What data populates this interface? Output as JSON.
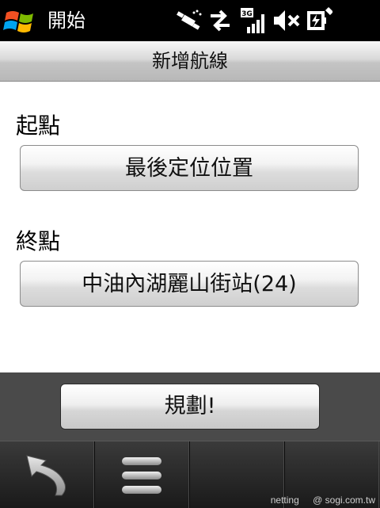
{
  "status_bar": {
    "start_label": "開始",
    "icons": [
      "windows-flag-icon",
      "gps-satellite-icon",
      "data-transfer-icon",
      "3g-signal-icon",
      "speaker-muted-icon",
      "battery-charging-icon"
    ],
    "signal_badge": "3G"
  },
  "title_bar": {
    "title": "新增航線"
  },
  "form": {
    "start_label": "起點",
    "start_value": "最後定位位置",
    "end_label": "終點",
    "end_value": "中油內湖麗山街站(24)"
  },
  "actions": {
    "plan_label": "規劃!"
  },
  "softkeys": {
    "icons": [
      "back-arrow-icon",
      "menu-icon"
    ]
  },
  "watermark": {
    "left": "netting",
    "right": "@ sogi.com.tw"
  },
  "colors": {
    "content_bg": "#ffffff",
    "action_bar_bg": "#4a4a4a",
    "status_bg": "#000000"
  }
}
